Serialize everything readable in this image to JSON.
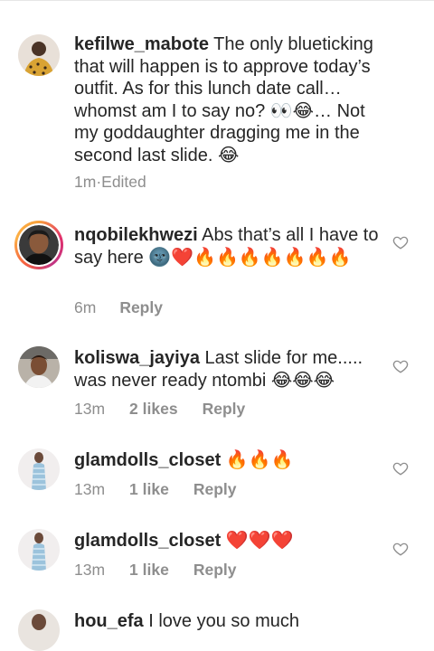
{
  "comments": [
    {
      "username": "kefilwe_mabote",
      "text": " The only blueticking that will happen is to approve today’s outfit. As for this lunch date call… whomst am I to say no? 👀😂… Not my goddaughter dragging me in the second last slide. 😂",
      "time": "1m",
      "edited": "Edited"
    },
    {
      "username": "nqobilekhwezi",
      "text": " Abs that’s all I have to say here 🌚❤️🔥🔥🔥🔥🔥🔥🔥",
      "time": "6m",
      "reply": "Reply"
    },
    {
      "username": "koliswa_jayiya",
      "text": " Last slide for me..... was never ready ntombi 😂😂😂",
      "time": "13m",
      "likes": "2 likes",
      "reply": "Reply"
    },
    {
      "username": "glamdolls_closet",
      "text": " 🔥🔥🔥",
      "time": "13m",
      "likes": "1 like",
      "reply": "Reply"
    },
    {
      "username": "glamdolls_closet",
      "text": " ❤️❤️❤️",
      "time": "13m",
      "likes": "1 like",
      "reply": "Reply"
    },
    {
      "username": "hou_efa",
      "text": " I love you so much"
    }
  ],
  "icons": {
    "like": "heart-outline-icon"
  },
  "colors": {
    "text": "#262626",
    "meta": "#8e8e8e",
    "story_ring": "#e1306c"
  }
}
